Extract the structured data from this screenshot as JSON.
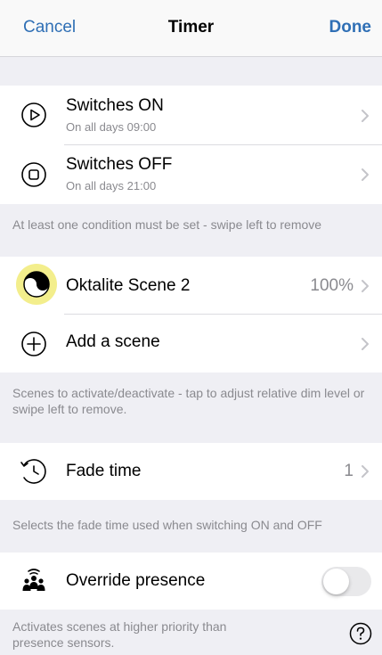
{
  "nav": {
    "cancel": "Cancel",
    "title": "Timer",
    "done": "Done"
  },
  "conditions": [
    {
      "title": "Switches ON",
      "subtitle": "On all days  09:00",
      "icon": "play-circle-icon"
    },
    {
      "title": "Switches OFF",
      "subtitle": "On all days  21:00",
      "icon": "stop-circle-icon"
    }
  ],
  "conditions_note": "At least one condition must be set - swipe left to remove",
  "scenes": [
    {
      "title": "Oktalite Scene 2",
      "value": "100%",
      "icon": "yin-yang-icon",
      "accent": "#f3ee8c"
    },
    {
      "title": "Add a scene",
      "icon": "add-circle-icon"
    }
  ],
  "scenes_note": "Scenes to activate/deactivate - tap to adjust relative dim level or swipe left to remove.",
  "fade": {
    "title": "Fade time",
    "value": "1",
    "icon": "fade-clock-icon"
  },
  "fade_note": "Selects the fade time used when switching ON and OFF",
  "presence": {
    "title": "Override presence",
    "icon": "presence-people-icon",
    "enabled": false
  },
  "presence_note": "Activates scenes at higher priority than presence sensors.",
  "help_icon": "help-icon",
  "colors": {
    "tint": "#2f6fb5",
    "background": "#efeff4",
    "secondary_text": "#8a8a8f",
    "toggle_off": "#e9e9eb"
  }
}
